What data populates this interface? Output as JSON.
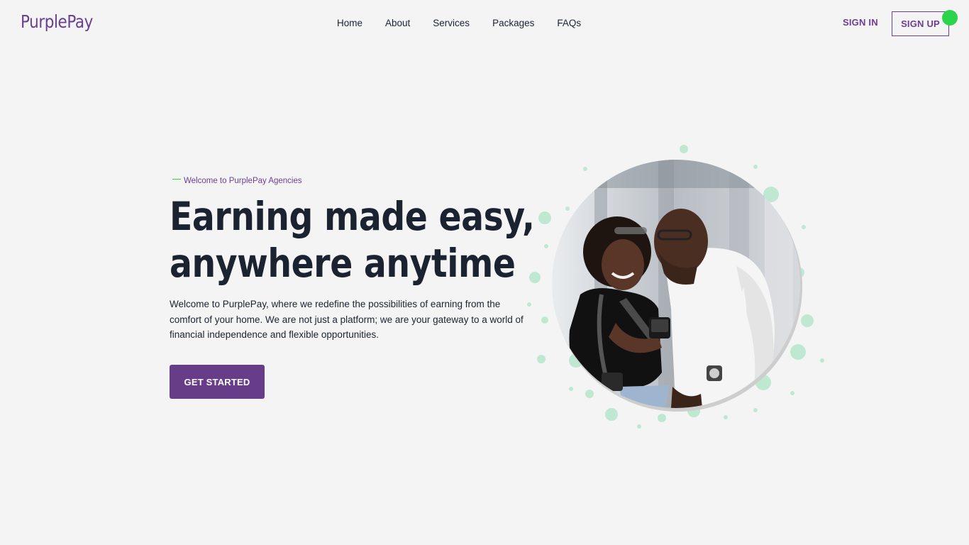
{
  "brand": {
    "name": "PurplePay",
    "primary_color": "#673d8a",
    "accent_color": "#2bd44a"
  },
  "nav": {
    "items": [
      "Home",
      "About",
      "Services",
      "Packages",
      "FAQs"
    ]
  },
  "auth": {
    "signin_label": "SIGN IN",
    "signup_label": "SIGN UP"
  },
  "hero": {
    "eyebrow": "Welcome to PurplePay Agencies",
    "title_line1": "Earning made easy,",
    "title_line2": "anywhere anytime",
    "description": "Welcome to PurplePay, where we redefine the possibilities of earning from the comfort of your home. We are not just a platform; we are your gateway to a world of financial independence and flexible opportunities.",
    "cta_label": "GET STARTED"
  },
  "illustration": {
    "icon": "people-with-phone-photo"
  }
}
